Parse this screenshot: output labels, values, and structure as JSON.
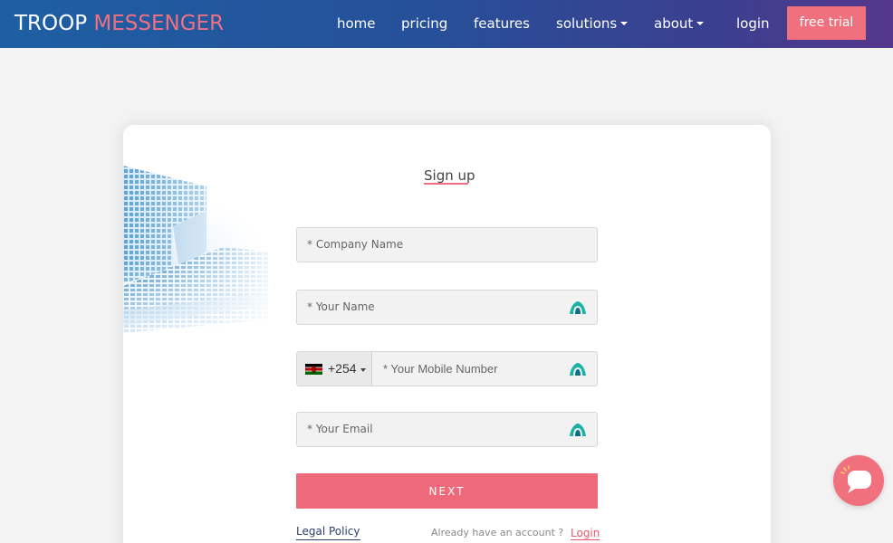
{
  "brand": {
    "logo_part1": "TROOP ",
    "logo_part2": "MESSENGER"
  },
  "nav": {
    "home": "home",
    "pricing": "pricing",
    "features": "features",
    "solutions": "solutions",
    "about": "about",
    "login": "login",
    "free_trial": "free trial"
  },
  "form": {
    "title": "Sign up",
    "company_placeholder": "* Company Name",
    "name_placeholder": "* Your Name",
    "country_code": "+254",
    "mobile_placeholder": "* Your Mobile Number",
    "email_placeholder": "* Your Email",
    "next_label": "NEXT",
    "legal_label": "Legal Policy",
    "already_text": "Already have an account ?",
    "login_label": "Login"
  },
  "colors": {
    "accent": "#f0707e",
    "nav_start": "#1e5fa3",
    "nav_end": "#55388b",
    "link": "#e8576a"
  },
  "icons": {
    "field_recognition": "cloud-key-icon",
    "chat": "chat-bubble-icon",
    "flag": "kenya-flag-icon"
  }
}
